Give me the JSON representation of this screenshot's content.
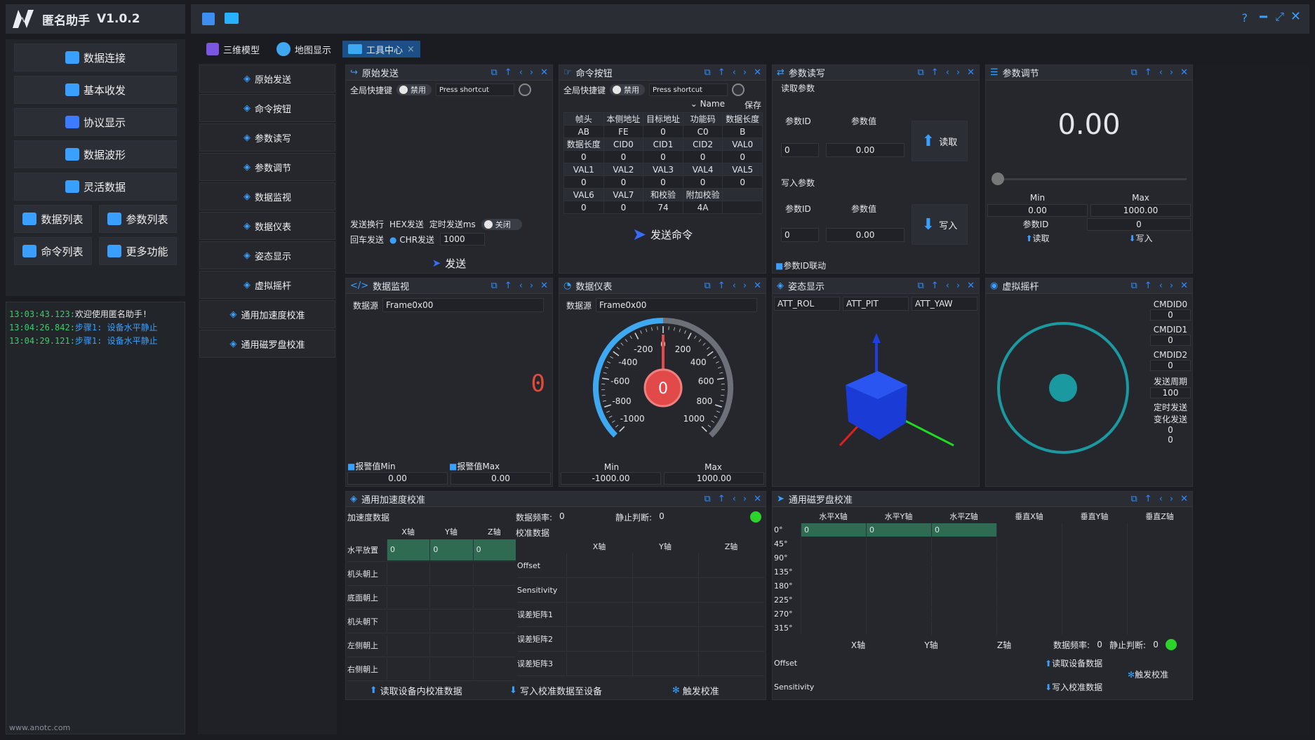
{
  "app": {
    "title": "匿名助手",
    "version": "V1.0.2",
    "website": "www.anotc.com"
  },
  "sidebar": {
    "items": [
      {
        "label": "数据连接",
        "icon": "link-icon"
      },
      {
        "label": "基本收发",
        "icon": "swap-icon"
      },
      {
        "label": "协议显示",
        "icon": "cube-icon"
      },
      {
        "label": "数据波形",
        "icon": "waveform-icon"
      },
      {
        "label": "灵活数据",
        "icon": "gear-icon"
      }
    ],
    "pairs": [
      [
        "数据列表",
        "参数列表"
      ],
      [
        "命令列表",
        "更多功能"
      ]
    ],
    "log": [
      {
        "time": "13:03:43.123:",
        "msg": "欢迎使用匿名助手!"
      },
      {
        "time": "13:04:26.842:",
        "msg": "步骤1: 设备水平静止"
      },
      {
        "time": "13:04:29.121:",
        "msg": "步骤1: 设备水平静止"
      }
    ]
  },
  "tabs": [
    "三维模型",
    "地图显示",
    "工具中心"
  ],
  "tools": [
    "原始发送",
    "命令按钮",
    "参数读写",
    "参数调节",
    "数据监视",
    "数据仪表",
    "姿态显示",
    "虚拟摇杆",
    "通用加速度校准",
    "通用磁罗盘校准"
  ],
  "raw": {
    "title": "原始发送",
    "hotkey": "全局快捷键",
    "disabled": "禁用",
    "shortcut": "Press shortcut",
    "newline": "发送换行",
    "hex": "HEX发送",
    "timed": "定时发送ms",
    "off": "关闭",
    "echo": "回车发送",
    "chr": "CHR发送",
    "interval": "1000",
    "send": "发送"
  },
  "cmd": {
    "title": "命令按钮",
    "hotkey": "全局快捷键",
    "disabled": "禁用",
    "shortcut": "Press shortcut",
    "name": "Name",
    "save": "保存",
    "rows": [
      [
        "帧头",
        "本侧地址",
        "目标地址",
        "功能码",
        "数据长度"
      ],
      [
        "AB",
        "FE",
        "0",
        "C0",
        "B"
      ],
      [
        "数据长度",
        "CID0",
        "CID1",
        "CID2",
        "VAL0"
      ],
      [
        "0",
        "0",
        "0",
        "0",
        "0"
      ],
      [
        "VAL1",
        "VAL2",
        "VAL3",
        "VAL4",
        "VAL5"
      ],
      [
        "0",
        "0",
        "0",
        "0",
        "0"
      ],
      [
        "VAL6",
        "VAL7",
        "和校验",
        "附加校验",
        ""
      ],
      [
        "0",
        "0",
        "74",
        "4A",
        ""
      ]
    ],
    "send": "发送命令"
  },
  "param": {
    "title": "参数读写",
    "read_title": "读取参数",
    "id": "参数ID",
    "val": "参数值",
    "id_v": "0",
    "val_v": "0.00",
    "read": "读取",
    "write_title": "写入参数",
    "write": "写入",
    "link": "参数ID联动"
  },
  "adjust": {
    "title": "参数调节",
    "value": "0.00",
    "min": "Min",
    "max": "Max",
    "min_v": "0.00",
    "max_v": "1000.00",
    "pid": "参数ID",
    "pid_v": "0",
    "read": "读取",
    "write": "写入"
  },
  "monitor": {
    "title": "数据监视",
    "src": "数据源",
    "frame": "Frame0x00",
    "digit": "0",
    "amin": "报警值Min",
    "amax": "报警值Max",
    "amin_v": "0.00",
    "amax_v": "0.00"
  },
  "meter": {
    "title": "数据仪表",
    "src": "数据源",
    "frame": "Frame0x00",
    "value": "0",
    "ticks": [
      "-200",
      "0",
      "200",
      "-400",
      "400",
      "-600",
      "600",
      "-800",
      "800",
      "-1000",
      "1000"
    ],
    "min": "Min",
    "max": "Max",
    "min_v": "-1000.00",
    "max_v": "1000.00",
    "level": 0.5
  },
  "att": {
    "title": "姿态显示",
    "cols": [
      "ATT_ROL",
      "ATT_PIT",
      "ATT_YAW"
    ]
  },
  "joy": {
    "title": "虚拟摇杆",
    "fields": [
      {
        "l": "CMDID0",
        "v": "0"
      },
      {
        "l": "CMDID1",
        "v": "0"
      },
      {
        "l": "CMDID2",
        "v": "0"
      },
      {
        "l": "发送周期",
        "v": "100"
      }
    ],
    "timed": "定时发送",
    "change": "变化发送",
    "t_v": "0",
    "c_v": "0"
  },
  "acc": {
    "title": "通用加速度校准",
    "data": "加速度数据",
    "freq": "数据频率:",
    "freq_v": "0",
    "still": "静止判断:",
    "still_v": "0",
    "calib": "校准数据",
    "axes": [
      "X轴",
      "Y轴",
      "Z轴"
    ],
    "rows": [
      "水平放置",
      "机头朝上",
      "底面朝上",
      "机头朝下",
      "左侧朝上",
      "右侧朝上"
    ],
    "vals": [
      "0",
      "0",
      "0"
    ],
    "crows": [
      "Offset",
      "Sensitivity",
      "误差矩阵1",
      "误差矩阵2",
      "误差矩阵3"
    ],
    "b1": "读取设备内校准数据",
    "b2": "写入校准数据至设备",
    "b3": "触发校准"
  },
  "mag": {
    "title": "通用磁罗盘校准",
    "cols": [
      "水平X轴",
      "水平Y轴",
      "水平Z轴",
      "垂直X轴",
      "垂直Y轴",
      "垂直Z轴"
    ],
    "angles": [
      "0°",
      "45°",
      "90°",
      "135°",
      "180°",
      "225°",
      "270°",
      "315°"
    ],
    "vals": [
      "0",
      "0",
      "0"
    ],
    "axes": [
      "X轴",
      "Y轴",
      "Z轴"
    ],
    "freq": "数据频率:",
    "freq_v": "0",
    "still": "静止判断:",
    "still_v": "0",
    "crows": [
      "Offset",
      "Sensitivity"
    ],
    "b1": "读取设备数据",
    "b2": "写入校准数据",
    "b3": "触发校准"
  }
}
